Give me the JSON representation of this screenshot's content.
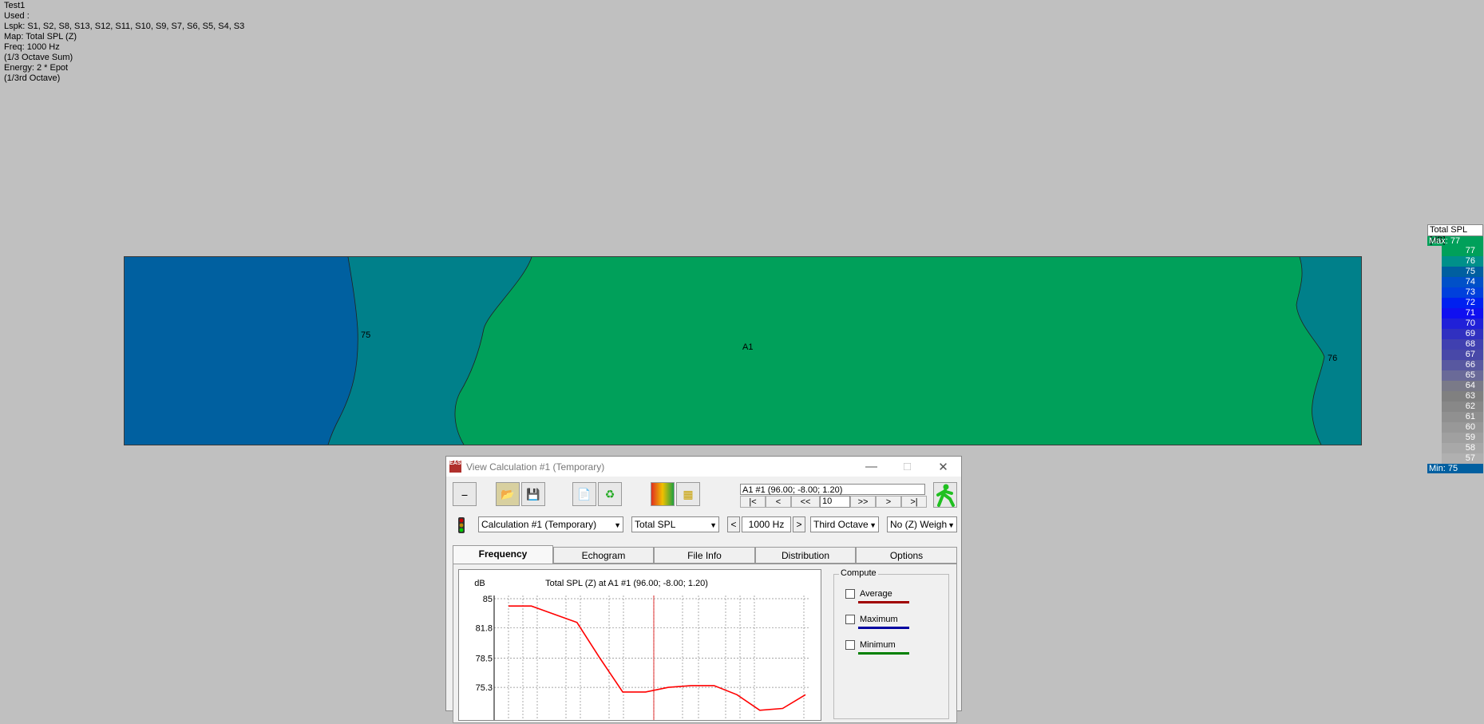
{
  "info": {
    "lines": [
      "Test1",
      "Used :",
      "Lspk: S1, S2, S8, S13, S12, S11, S10, S9, S7, S6, S5, S4, S3",
      "Map: Total SPL (Z)",
      "Freq: 1000 Hz",
      "(1/3 Octave Sum)",
      "Energy: 2 * Epot",
      "(1/3rd Octave)"
    ]
  },
  "map": {
    "labels": {
      "c75": "75",
      "c76": "76",
      "a1": "A1"
    },
    "colors": {
      "blue": "#0060a0",
      "teal": "#00808a",
      "green": "#00a05a"
    }
  },
  "legend": {
    "title": "Total SPL [dB]",
    "max": "Max:  77",
    "min": "Min:  75",
    "rows": [
      {
        "v": "77",
        "c": "#00a05a"
      },
      {
        "v": "76",
        "c": "#00908a"
      },
      {
        "v": "75",
        "c": "#005fa0"
      },
      {
        "v": "74",
        "c": "#0050c8"
      },
      {
        "v": "73",
        "c": "#0040dc"
      },
      {
        "v": "72",
        "c": "#0020f0"
      },
      {
        "v": "71",
        "c": "#1010f0"
      },
      {
        "v": "70",
        "c": "#2020d8"
      },
      {
        "v": "69",
        "c": "#3030c0"
      },
      {
        "v": "68",
        "c": "#4040b0"
      },
      {
        "v": "67",
        "c": "#4848a8"
      },
      {
        "v": "66",
        "c": "#5858a0"
      },
      {
        "v": "65",
        "c": "#6a6a98"
      },
      {
        "v": "64",
        "c": "#7a7a88"
      },
      {
        "v": "63",
        "c": "#808080"
      },
      {
        "v": "62",
        "c": "#888888"
      },
      {
        "v": "61",
        "c": "#909090"
      },
      {
        "v": "60",
        "c": "#989898"
      },
      {
        "v": "59",
        "c": "#a0a0a0"
      },
      {
        "v": "58",
        "c": "#a8a8a8"
      },
      {
        "v": "57",
        "c": "#b0b0b0"
      }
    ]
  },
  "dialog": {
    "title": "View Calculation #1 (Temporary)",
    "icon_text": "EASE",
    "location": "A1 #1  (96.00; -8.00; 1.20)",
    "nav": {
      "first": "|<",
      "prev": "<",
      "prevfast": "<<",
      "step": "10",
      "nextfast": ">>",
      "next": ">",
      "last": ">|"
    },
    "selects": {
      "calc": "Calculation #1 (Temporary)",
      "quantity": "Total SPL",
      "freq": "1000 Hz",
      "band": "Third Octave",
      "weight": "No (Z) Weigh"
    },
    "freq_prev": "<",
    "freq_next": ">",
    "tabs": [
      "Frequency",
      "Echogram",
      "File Info",
      "Distribution",
      "Options"
    ],
    "compute": {
      "title": "Compute",
      "items": [
        {
          "label": "Average",
          "color": "#a00000"
        },
        {
          "label": "Maximum",
          "color": "#0000a0"
        },
        {
          "label": "Minimum",
          "color": "#008000"
        }
      ]
    }
  },
  "chart_data": {
    "type": "line",
    "title": "Total SPL (Z) at A1 #1  (96.00; -8.00; 1.20)",
    "ylabel": "dB",
    "yticks": [
      "85",
      "81.8",
      "78.5",
      "75.3"
    ],
    "ylim": [
      72,
      85
    ],
    "series": [
      {
        "values": [
          84.2,
          84.2,
          83.3,
          82.4,
          78.5,
          74.8,
          74.8,
          75.3,
          75.5,
          75.5,
          74.5,
          72.8,
          73.0,
          74.5
        ],
        "color": "#ff0000"
      }
    ]
  }
}
